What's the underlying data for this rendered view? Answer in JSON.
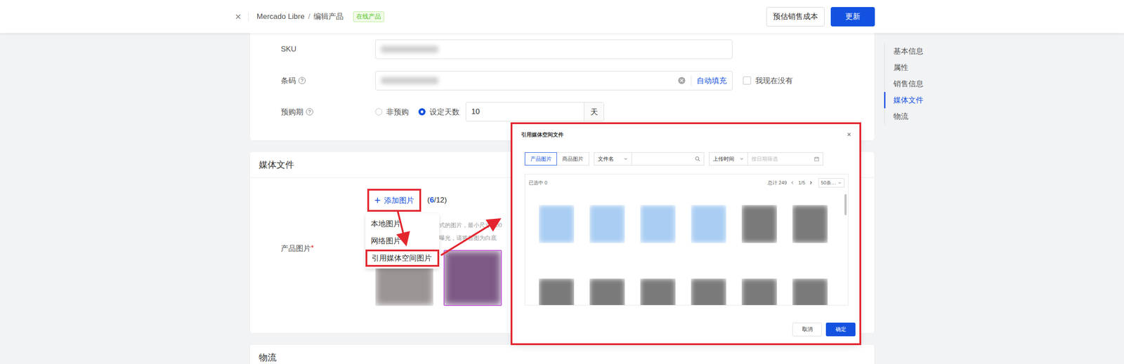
{
  "header": {
    "close": "×",
    "breadcrumb": [
      {
        "label": "Mercado Libre"
      },
      {
        "label": "编辑产品"
      }
    ],
    "separator": "/",
    "badge": "在线产品",
    "buttons": [
      {
        "label": "预估销售成本",
        "primary": false
      },
      {
        "label": "更新",
        "primary": true
      }
    ]
  },
  "nav": [
    {
      "label": "基本信息",
      "selected": false
    },
    {
      "label": "属性",
      "selected": false
    },
    {
      "label": "销售信息",
      "selected": false
    },
    {
      "label": "媒体文件",
      "selected": true
    },
    {
      "label": "物流",
      "selected": false
    }
  ],
  "basic": {
    "sku": {
      "label": "SKU"
    },
    "barcode": {
      "label": "条码",
      "help": "?",
      "action": "自动填充",
      "checkbox": {
        "label": "我现在没有",
        "checked": false
      }
    },
    "preorder": {
      "label": "预购期",
      "help": "?",
      "options": [
        {
          "label": "非预购",
          "selected": false
        },
        {
          "label": "设定天数",
          "selected": true
        }
      ],
      "value": "10",
      "unit": "天"
    }
  },
  "media": {
    "title": "媒体文件",
    "field": {
      "label": "产品图片",
      "required": "*"
    },
    "add_button": {
      "icon": "+",
      "label": "添加图片",
      "annotated": true
    },
    "count": {
      "prefix": "(",
      "value": "6",
      "suffix": "/12)"
    },
    "menu": [
      {
        "label": "本地图片",
        "annotated": false
      },
      {
        "label": "网络图片",
        "annotated": false
      },
      {
        "label": "引用媒体空间图片",
        "annotated": true
      }
    ],
    "hint": [
      "式的图片，最小尺寸 500",
      "曝光，请将首图为白底"
    ],
    "thumbnails": [
      {
        "color": "#9a9494",
        "framed": false
      },
      {
        "color": "#7d5a86",
        "framed": true
      }
    ]
  },
  "modal": {
    "title": "引用媒体空间文件",
    "close": "×",
    "annotated": true,
    "tabs": [
      {
        "label": "产品图片",
        "selected": true
      },
      {
        "label": "商品图片",
        "selected": false
      }
    ],
    "filters": {
      "field": "文件名",
      "time_field": "上传时间",
      "date_placeholder": "按日期筛选"
    },
    "selected_count": "已选中 0",
    "total": "总计 249",
    "page": "1/5",
    "page_size": "50条…",
    "tiles": [
      {
        "kind": "folder"
      },
      {
        "kind": "folder"
      },
      {
        "kind": "folder"
      },
      {
        "kind": "folder"
      },
      {
        "kind": "image"
      },
      {
        "kind": "image"
      },
      {
        "kind": "image"
      },
      {
        "kind": "image"
      },
      {
        "kind": "image"
      },
      {
        "kind": "image"
      },
      {
        "kind": "image"
      },
      {
        "kind": "image"
      }
    ],
    "buttons": [
      {
        "label": "取消",
        "primary": false
      },
      {
        "label": "确定",
        "primary": true
      }
    ]
  },
  "logistics": {
    "title": "物流"
  }
}
